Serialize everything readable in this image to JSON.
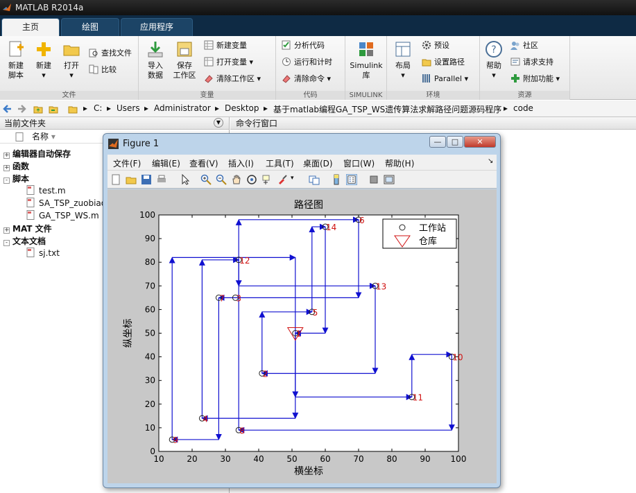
{
  "window": {
    "title": "MATLAB R2014a"
  },
  "tabs": [
    {
      "label": "主页",
      "active": true
    },
    {
      "label": "绘图",
      "active": false
    },
    {
      "label": "应用程序",
      "active": false
    }
  ],
  "ribbon": {
    "groups": {
      "file": "文件",
      "variable": "变量",
      "code": "代码",
      "simulink": "SIMULINK",
      "env": "环境",
      "resources": "资源"
    },
    "new_script": [
      "新建",
      "脚本"
    ],
    "new": "新建",
    "open": "打开",
    "find_files": "查找文件",
    "compare": "比较",
    "import": [
      "导入",
      "数据"
    ],
    "save_ws": [
      "保存",
      "工作区"
    ],
    "new_var": "新建变量",
    "open_var": "打开变量",
    "clear_ws": "清除工作区",
    "analyze": "分析代码",
    "run_time": "运行和计时",
    "clear_cmd": "清除命令",
    "simulink": [
      "Simulink",
      "库"
    ],
    "layout": "布局",
    "prefs": "预设",
    "set_path": "设置路径",
    "parallel": "Parallel",
    "help": "帮助",
    "community": "社区",
    "support": "请求支持",
    "addons": "附加功能"
  },
  "address": {
    "path": [
      "C:",
      "Users",
      "Administrator",
      "Desktop",
      "基于matlab编程GA_TSP_WS遗传算法求解路径问题源码程序",
      "code"
    ]
  },
  "current_folder": {
    "title": "当前文件夹",
    "col_name": "名称",
    "tree": [
      {
        "label": "编辑器自动保存",
        "sign": "+",
        "bold": true
      },
      {
        "label": "函数",
        "sign": "+",
        "bold": true
      },
      {
        "label": "脚本",
        "sign": "-",
        "bold": true
      },
      {
        "label": "test.m",
        "sign": "",
        "bold": false
      },
      {
        "label": "SA_TSP_zuobiao",
        "sign": "",
        "bold": false
      },
      {
        "label": "GA_TSP_WS.m",
        "sign": "",
        "bold": false
      },
      {
        "label": "MAT 文件",
        "sign": "+",
        "bold": true
      },
      {
        "label": "文本文档",
        "sign": "-",
        "bold": true
      },
      {
        "label": "sj.txt",
        "sign": "",
        "bold": false
      }
    ]
  },
  "command_window": {
    "title": "命令行窗口"
  },
  "figure": {
    "title": "Figure 1",
    "menu": [
      "文件(F)",
      "编辑(E)",
      "查看(V)",
      "插入(I)",
      "工具(T)",
      "桌面(D)",
      "窗口(W)",
      "帮助(H)"
    ]
  },
  "chart_data": {
    "type": "scatter",
    "title": "路径图",
    "xlabel": "横坐标",
    "ylabel": "纵坐标",
    "xlim": [
      10,
      100
    ],
    "ylim": [
      0,
      100
    ],
    "xticks": [
      10,
      20,
      30,
      40,
      50,
      60,
      70,
      80,
      90,
      100
    ],
    "yticks": [
      0,
      10,
      20,
      30,
      40,
      50,
      60,
      70,
      80,
      90,
      100
    ],
    "legend": {
      "placement": "top-right",
      "entries": [
        "工作站",
        "仓库"
      ]
    },
    "depot": {
      "x": 51,
      "y": 50
    },
    "stations": [
      {
        "id": "1",
        "x": 51,
        "y": 50
      },
      {
        "id": "2",
        "x": 41,
        "y": 33
      },
      {
        "id": "3",
        "x": 33,
        "y": 65
      },
      {
        "id": "4",
        "x": 23,
        "y": 14
      },
      {
        "id": "5",
        "x": 56,
        "y": 59
      },
      {
        "id": "6",
        "x": 70,
        "y": 98
      },
      {
        "id": "7",
        "x": 28,
        "y": 65
      },
      {
        "id": "8",
        "x": 34,
        "y": 9
      },
      {
        "id": "9",
        "x": 14,
        "y": 5
      },
      {
        "id": "10",
        "x": 98,
        "y": 40
      },
      {
        "id": "11",
        "x": 86,
        "y": 23
      },
      {
        "id": "12",
        "x": 34,
        "y": 81
      },
      {
        "id": "13",
        "x": 75,
        "y": 70
      },
      {
        "id": "14",
        "x": 60,
        "y": 95
      }
    ],
    "route": [
      [
        51,
        50
      ],
      [
        51,
        23
      ],
      [
        86,
        23
      ],
      [
        86,
        41
      ],
      [
        98,
        41
      ],
      [
        98,
        9
      ],
      [
        34,
        9
      ],
      [
        34,
        98
      ],
      [
        70,
        98
      ],
      [
        70,
        65
      ],
      [
        28,
        65
      ],
      [
        28,
        5
      ],
      [
        14,
        5
      ],
      [
        14,
        82
      ],
      [
        51,
        82
      ],
      [
        51,
        14
      ],
      [
        23,
        14
      ],
      [
        23,
        81
      ],
      [
        34,
        81
      ],
      [
        34,
        70
      ],
      [
        75,
        70
      ],
      [
        75,
        33
      ],
      [
        41,
        33
      ],
      [
        41,
        59
      ],
      [
        56,
        59
      ],
      [
        56,
        95
      ],
      [
        60,
        95
      ],
      [
        60,
        50
      ],
      [
        51,
        50
      ]
    ]
  }
}
